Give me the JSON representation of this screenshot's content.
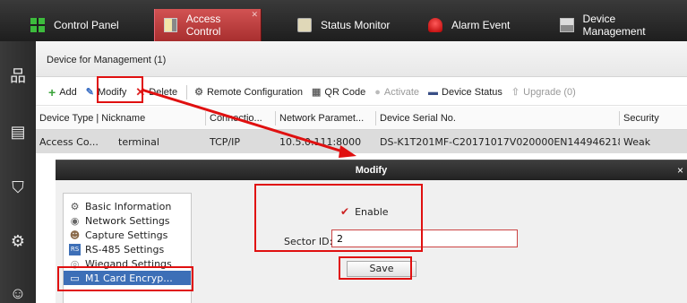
{
  "topbar": {
    "tabs": [
      {
        "label": "Control Panel",
        "icon": "grid-icon"
      },
      {
        "label": "Access Control",
        "icon": "door-icon",
        "active": true
      },
      {
        "label": "Status Monitor",
        "icon": "monitor-icon"
      },
      {
        "label": "Alarm Event",
        "icon": "alarm-icon"
      },
      {
        "label": "Device Management",
        "icon": "device-icon"
      }
    ]
  },
  "sidebar": {
    "icons": [
      "network-icon",
      "document-icon",
      "shield-icon",
      "settings-icon",
      "person-icon"
    ]
  },
  "main": {
    "section_title": "Device for Management (1)",
    "toolbar": {
      "add": "Add",
      "modify": "Modify",
      "delete": "Delete",
      "remote_config": "Remote Configuration",
      "qr_code": "QR Code",
      "activate": "Activate",
      "device_status": "Device Status",
      "upgrade": "Upgrade (0)"
    },
    "table": {
      "headers": {
        "type_nick": "Device Type | Nickname",
        "connection": "Connectio...",
        "network": "Network Paramet...",
        "serial": "Device Serial No.",
        "security": "Security"
      },
      "row": {
        "type": "Access Co...",
        "nickname": "terminal",
        "connection": "TCP/IP",
        "network": "10.5.0.111:8000",
        "serial": "DS-K1T201MF-C20171017V020000EN144946218",
        "security": "Weak"
      }
    }
  },
  "dialog": {
    "title": "Modify",
    "close": "×",
    "nav": [
      "Basic Information",
      "Network Settings",
      "Capture Settings",
      "RS-485 Settings",
      "Wiegand Settings",
      "M1 Card Encryp..."
    ],
    "enable_label": "Enable",
    "enable_checked": true,
    "sector_label": "Sector ID:",
    "sector_value": "2",
    "save": "Save"
  },
  "colors": {
    "accent_red": "#e01010",
    "active_tab": "#b83a3a",
    "selection_blue": "#3d6fb7"
  }
}
